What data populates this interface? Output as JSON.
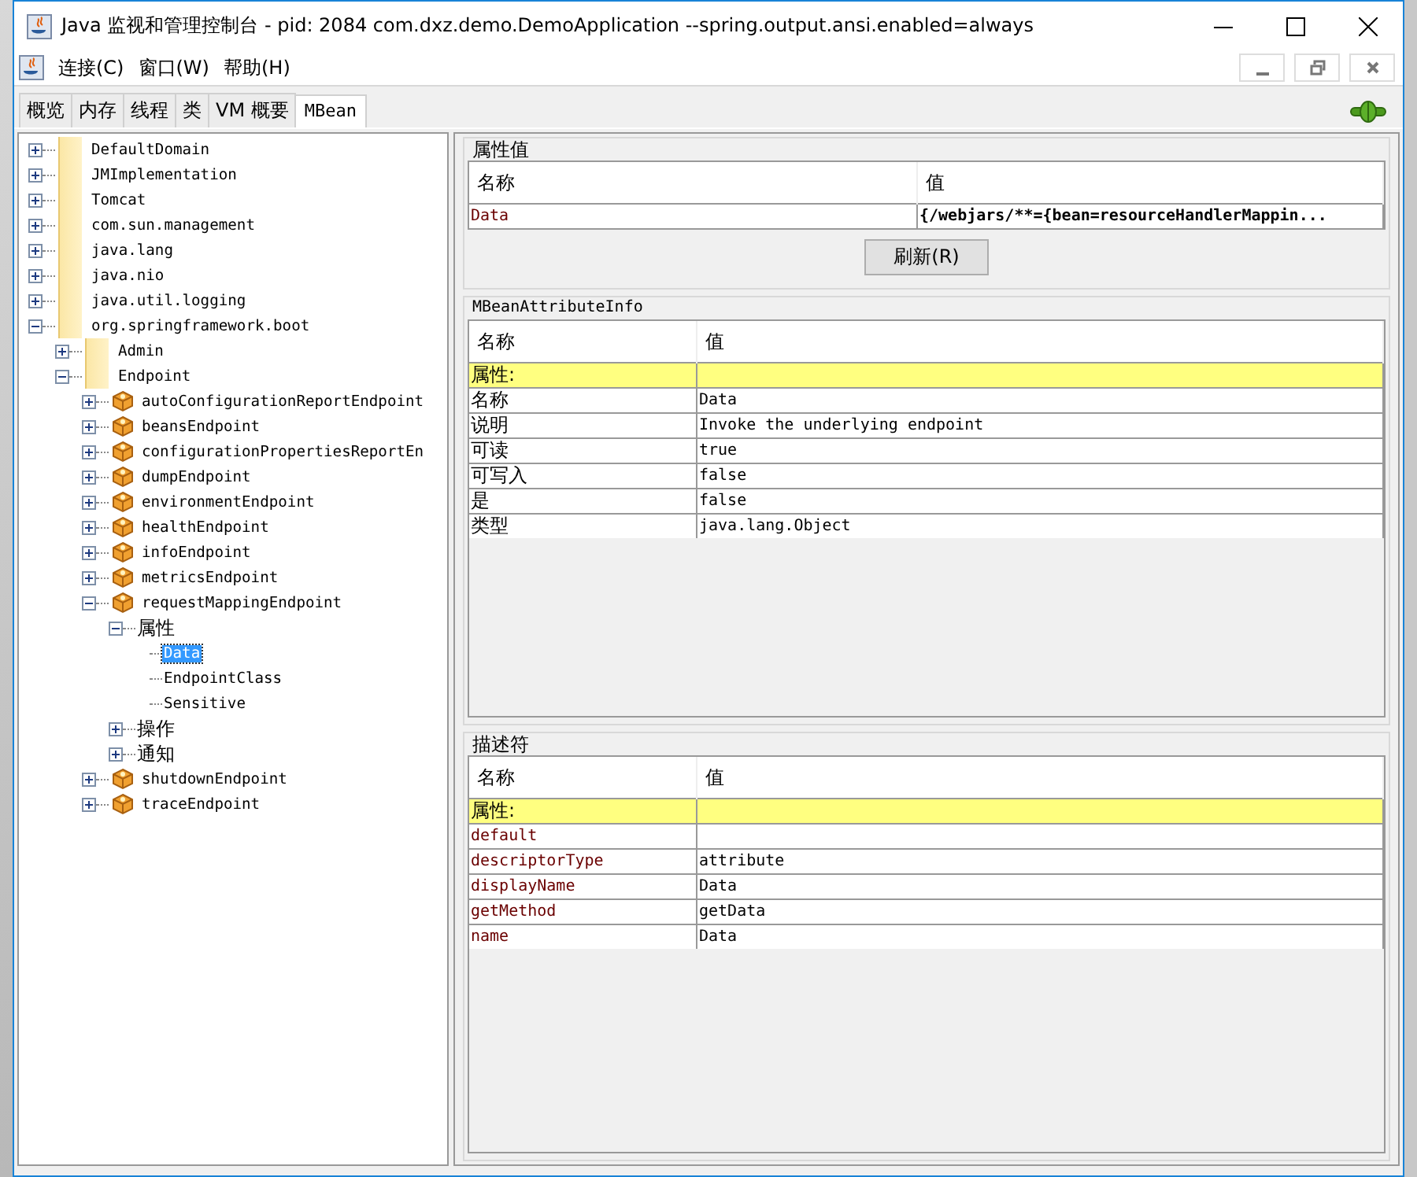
{
  "window": {
    "title": "Java 监视和管理控制台 - pid: 2084 com.dxz.demo.DemoApplication --spring.output.ansi.enabled=always"
  },
  "menu": [
    {
      "label": "连接(C)"
    },
    {
      "label": "窗口(W)"
    },
    {
      "label": "帮助(H)"
    }
  ],
  "tabs": [
    {
      "label": "概览",
      "selected": false
    },
    {
      "label": "内存",
      "selected": false
    },
    {
      "label": "线程",
      "selected": false
    },
    {
      "label": "类",
      "selected": false
    },
    {
      "label": "VM 概要",
      "selected": false
    },
    {
      "label": "MBean",
      "selected": true
    }
  ],
  "tree": [
    {
      "label": "DefaultDomain",
      "kind": "folder",
      "expanded": false,
      "selected": false
    },
    {
      "label": "JMImplementation",
      "kind": "folder",
      "expanded": false,
      "selected": false
    },
    {
      "label": "Tomcat",
      "kind": "folder",
      "expanded": false,
      "selected": false
    },
    {
      "label": "com.sun.management",
      "kind": "folder",
      "expanded": false,
      "selected": false
    },
    {
      "label": "java.lang",
      "kind": "folder",
      "expanded": false,
      "selected": false
    },
    {
      "label": "java.nio",
      "kind": "folder",
      "expanded": false,
      "selected": false
    },
    {
      "label": "java.util.logging",
      "kind": "folder",
      "expanded": false,
      "selected": false
    },
    {
      "label": "org.springframework.boot",
      "kind": "folder",
      "expanded": true,
      "selected": false,
      "children": [
        {
          "label": "Admin",
          "kind": "folder",
          "expanded": false,
          "selected": false
        },
        {
          "label": "Endpoint",
          "kind": "folder",
          "expanded": true,
          "selected": false,
          "children": [
            {
              "label": "autoConfigurationReportEndpoint",
              "kind": "bean",
              "expanded": false,
              "selected": false
            },
            {
              "label": "beansEndpoint",
              "kind": "bean",
              "expanded": false,
              "selected": false
            },
            {
              "label": "configurationPropertiesReportEn",
              "kind": "bean",
              "expanded": false,
              "selected": false
            },
            {
              "label": "dumpEndpoint",
              "kind": "bean",
              "expanded": false,
              "selected": false
            },
            {
              "label": "environmentEndpoint",
              "kind": "bean",
              "expanded": false,
              "selected": false
            },
            {
              "label": "healthEndpoint",
              "kind": "bean",
              "expanded": false,
              "selected": false
            },
            {
              "label": "infoEndpoint",
              "kind": "bean",
              "expanded": false,
              "selected": false
            },
            {
              "label": "metricsEndpoint",
              "kind": "bean",
              "expanded": false,
              "selected": false
            },
            {
              "label": "requestMappingEndpoint",
              "kind": "bean",
              "expanded": true,
              "selected": false,
              "children": [
                {
                  "label": "属性",
                  "kind": "category",
                  "expanded": true,
                  "selected": false,
                  "children": [
                    {
                      "label": "Data",
                      "selected": true
                    },
                    {
                      "label": "EndpointClass",
                      "selected": false
                    },
                    {
                      "label": "Sensitive",
                      "selected": false
                    }
                  ]
                },
                {
                  "label": "操作",
                  "kind": "category",
                  "expanded": false,
                  "selected": false
                },
                {
                  "label": "通知",
                  "kind": "category",
                  "expanded": false,
                  "selected": false
                }
              ]
            },
            {
              "label": "shutdownEndpoint",
              "kind": "bean",
              "expanded": false,
              "selected": false
            },
            {
              "label": "traceEndpoint",
              "kind": "bean",
              "expanded": false,
              "selected": false
            }
          ]
        }
      ]
    }
  ],
  "attribute_values": {
    "title": "属性值",
    "columns": [
      "名称",
      "值"
    ],
    "rows": [
      {
        "name": "Data",
        "value": "{/webjars/**={bean=resourceHandlerMappin..."
      }
    ],
    "refresh_button": "刷新(R)"
  },
  "attribute_info": {
    "title": "MBeanAttributeInfo",
    "columns": [
      "名称",
      "值"
    ],
    "rows": [
      {
        "kind": "section",
        "name": "属性:"
      },
      {
        "kind": "entry",
        "name": "名称",
        "value": "Data"
      },
      {
        "kind": "entry",
        "name": "说明",
        "value": "Invoke the underlying endpoint"
      },
      {
        "kind": "entry",
        "name": "可读",
        "value": "true"
      },
      {
        "kind": "entry",
        "name": "可写入",
        "value": "false"
      },
      {
        "kind": "entry",
        "name": "是",
        "value": "false"
      },
      {
        "kind": "entry",
        "name": "类型",
        "value": "java.lang.Object"
      }
    ]
  },
  "descriptor": {
    "title": "描述符",
    "columns": [
      "名称",
      "值"
    ],
    "rows": [
      {
        "kind": "section",
        "name": "属性:"
      },
      {
        "kind": "entry",
        "name": "default"
      },
      {
        "kind": "entry",
        "name": "descriptorType",
        "value": "attribute"
      },
      {
        "kind": "entry",
        "name": "displayName",
        "value": "Data"
      },
      {
        "kind": "entry",
        "name": "getMethod",
        "value": "getData"
      },
      {
        "kind": "entry",
        "name": "name",
        "value": "Data"
      }
    ]
  }
}
